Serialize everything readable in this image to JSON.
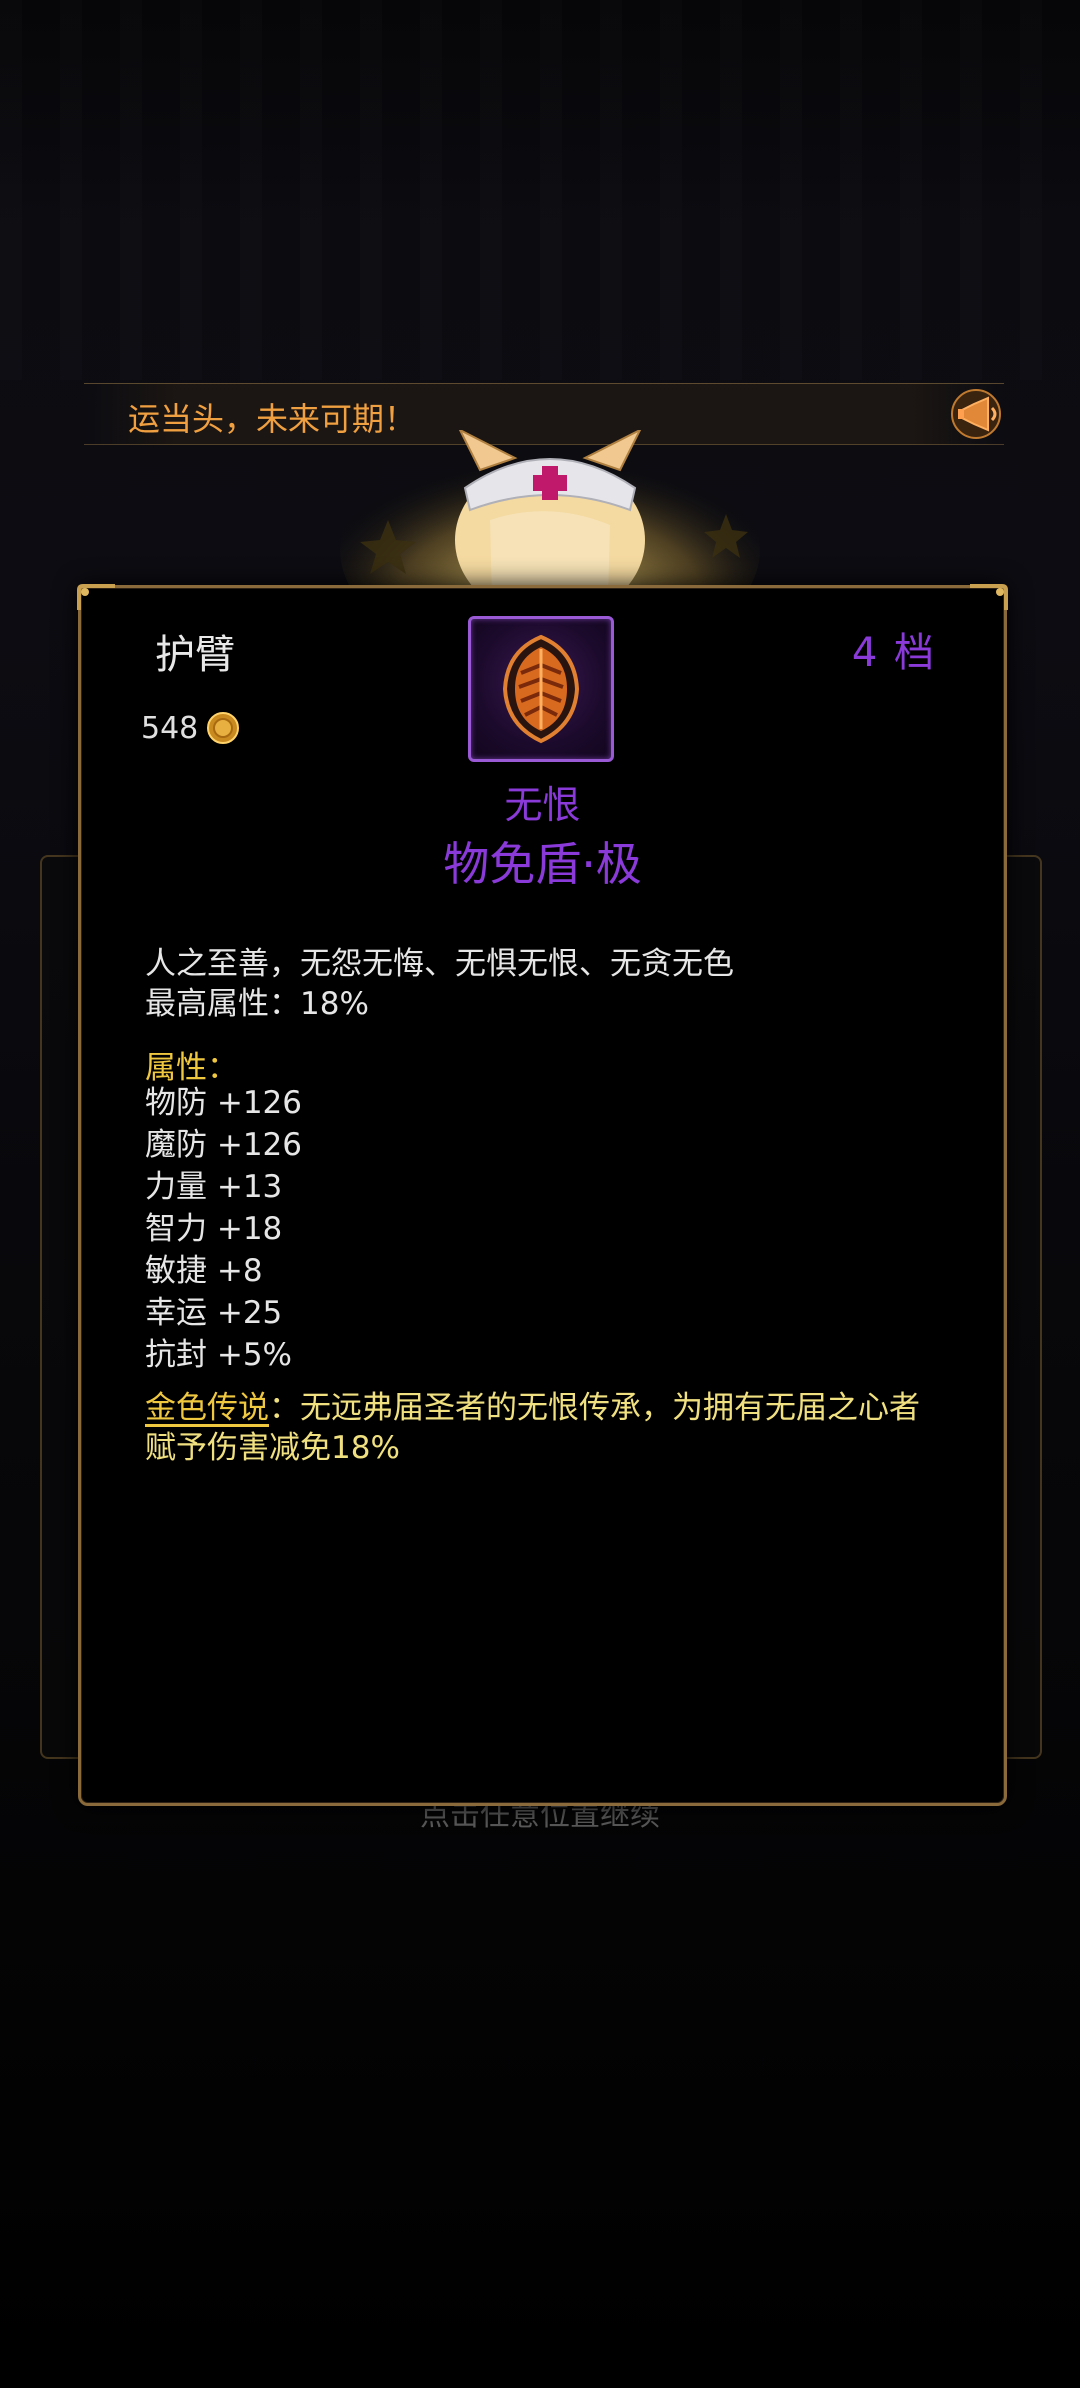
{
  "ticker": {
    "text": "运当头，未来可期！",
    "speaker_icon": "megaphone-icon"
  },
  "item": {
    "slot": "护臂",
    "tier": "4 档",
    "price": "548",
    "currency_icon": "gold-coin-icon",
    "name": "无恨",
    "full_name": "物免盾·极",
    "description": "人之至善，无怨无悔、无惧无恨、无贪无色",
    "max_attribute": "最高属性：18%",
    "attributes_title": "属性：",
    "attributes": [
      "物防 +126",
      "魔防 +126",
      "力量 +13",
      "智力 +18",
      "敏捷 +8",
      "幸运 +25",
      "抗封 +5%"
    ],
    "legend_label": "金色传说",
    "legend_text": "：无远弗届圣者的无恨传承，为拥有无届之心者赋予伤害减免18%",
    "rarity_color": "#8a3ad8"
  },
  "hint": "点击任意位置继续"
}
